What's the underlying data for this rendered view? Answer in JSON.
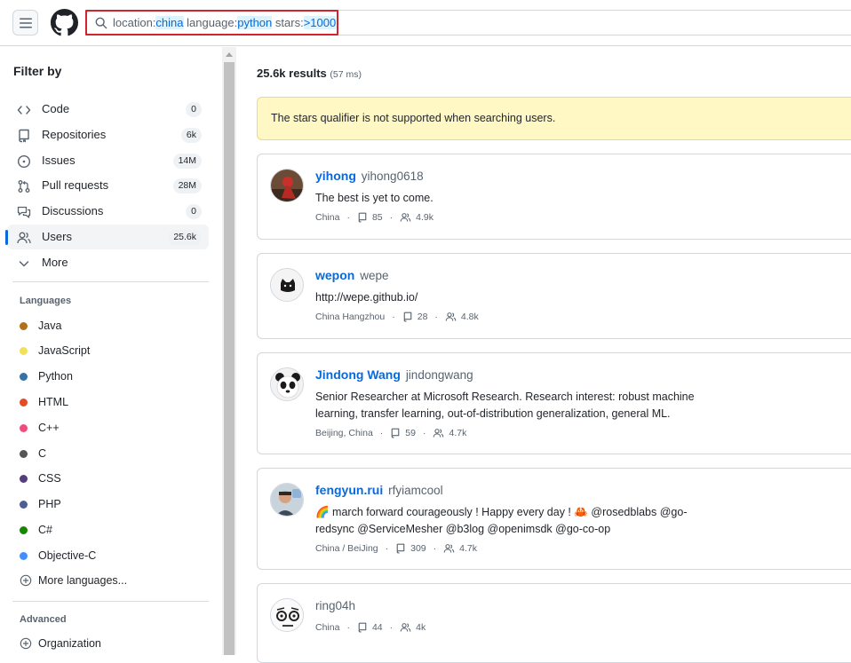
{
  "search": {
    "query_parts": [
      {
        "key": "location:",
        "value": "china"
      },
      {
        "key": " language:",
        "value": "python"
      },
      {
        "key": " stars:",
        "value": ">1000"
      }
    ]
  },
  "sidebar": {
    "title": "Filter by",
    "nav": [
      {
        "label": "Code",
        "count": "0",
        "icon": "code-icon"
      },
      {
        "label": "Repositories",
        "count": "6k",
        "icon": "repo-icon"
      },
      {
        "label": "Issues",
        "count": "14M",
        "icon": "issue-icon"
      },
      {
        "label": "Pull requests",
        "count": "28M",
        "icon": "pull-request-icon"
      },
      {
        "label": "Discussions",
        "count": "0",
        "icon": "discussion-icon"
      },
      {
        "label": "Users",
        "count": "25.6k",
        "icon": "people-icon",
        "active": true
      },
      {
        "label": "More",
        "count": "",
        "icon": "chevron-down-icon"
      }
    ],
    "languages_title": "Languages",
    "languages": [
      {
        "name": "Java",
        "color": "#b07219"
      },
      {
        "name": "JavaScript",
        "color": "#f1e05a"
      },
      {
        "name": "Python",
        "color": "#3572A5"
      },
      {
        "name": "HTML",
        "color": "#e34c26"
      },
      {
        "name": "C++",
        "color": "#f34b7d"
      },
      {
        "name": "C",
        "color": "#555555"
      },
      {
        "name": "CSS",
        "color": "#563d7c"
      },
      {
        "name": "PHP",
        "color": "#4F5D95"
      },
      {
        "name": "C#",
        "color": "#178600"
      },
      {
        "name": "Objective-C",
        "color": "#438eff"
      }
    ],
    "more_languages": "More languages...",
    "advanced_title": "Advanced",
    "organization": "Organization"
  },
  "results": {
    "count": "25.6k results",
    "time": "(57 ms)",
    "banner": "The stars qualifier is not supported when searching users.",
    "users": [
      {
        "name": "yihong",
        "login": "yihong0618",
        "bio": [
          "The best is yet to come."
        ],
        "location": "China",
        "repos": "85",
        "followers": "4.9k"
      },
      {
        "name": "wepon",
        "login": "wepe",
        "bio": [
          "http://wepe.github.io/"
        ],
        "location": "China Hangzhou",
        "repos": "28",
        "followers": "4.8k"
      },
      {
        "name": "Jindong Wang",
        "login": "jindongwang",
        "bio": [
          "Senior Researcher at Microsoft Research. Research interest: robust machine",
          "learning, transfer learning, out-of-distribution generalization, general ML."
        ],
        "location": "Beijing, China",
        "repos": "59",
        "followers": "4.7k"
      },
      {
        "name": "fengyun.rui",
        "login": "rfyiamcool",
        "bio": [
          "🌈 march forward courageously ! Happy every day ! 🦀 @rosedblabs @go-",
          "redsync @ServiceMesher @b3log @openimsdk @go-co-op"
        ],
        "location": "China / BeiJing",
        "repos": "309",
        "followers": "4.7k"
      },
      {
        "name": "",
        "login": "ring04h",
        "bio": [],
        "location": "China",
        "repos": "44",
        "followers": "4k"
      }
    ]
  },
  "colors": {
    "accent": "#0969da",
    "highlight": "#d1242f",
    "banner": "#fff8c5"
  }
}
